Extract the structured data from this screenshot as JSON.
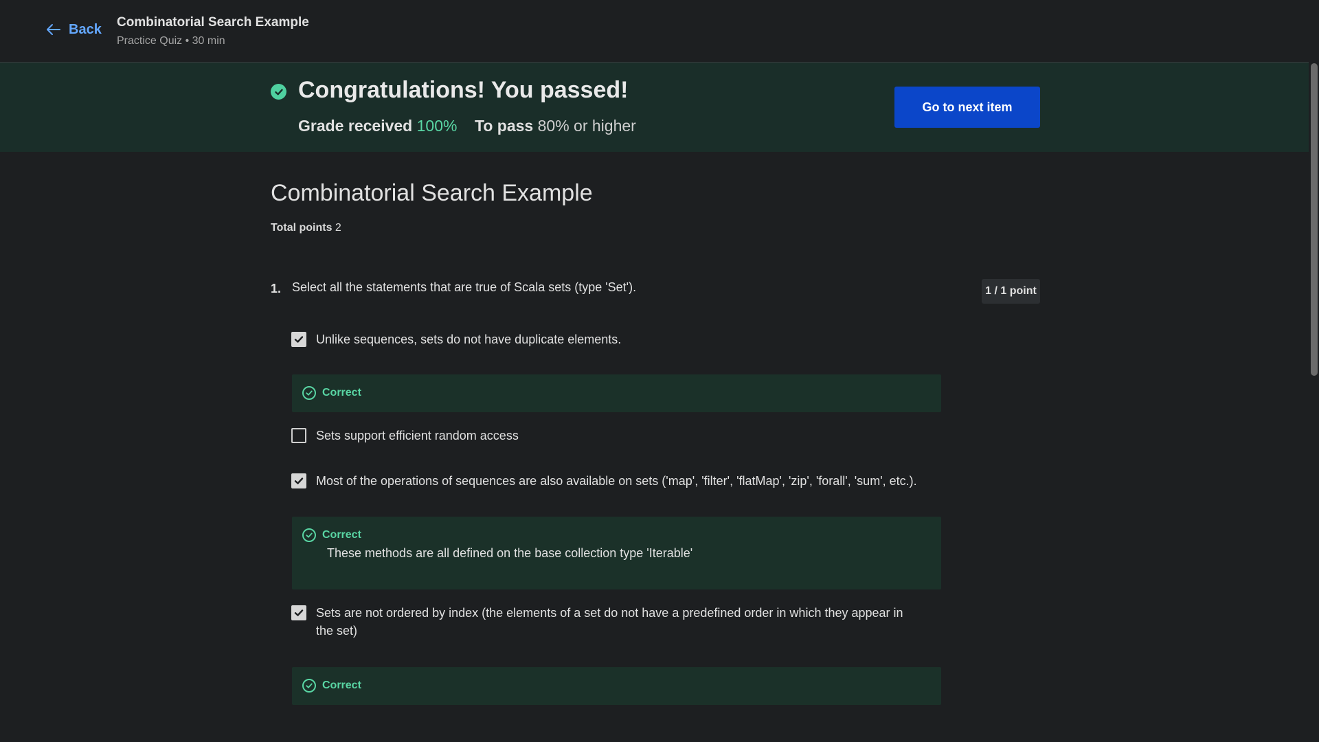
{
  "header": {
    "back_label": "Back",
    "title": "Combinatorial Search Example",
    "subtitle": "Practice Quiz • 30 min"
  },
  "banner": {
    "headline": "Congratulations! You passed!",
    "grade_label": "Grade received",
    "grade_value": "100%",
    "pass_label": "To pass",
    "pass_value": "80% or higher",
    "next_button": "Go to next item"
  },
  "quiz": {
    "title": "Combinatorial Search Example",
    "total_points_label": "Total points",
    "total_points_value": "2"
  },
  "question": {
    "number": "1.",
    "text": "Select all the statements that are true of Scala sets (type 'Set').",
    "points": "1 / 1 point",
    "options": [
      {
        "text": "Unlike sequences, sets do not have duplicate elements.",
        "checked": true
      },
      {
        "text": "Sets support efficient random access",
        "checked": false
      },
      {
        "text": "Most of the operations of sequences are also available on sets ('map', 'filter', 'flatMap', 'zip', 'forall', 'sum', etc.).",
        "checked": true
      },
      {
        "text": "Sets are not ordered by index (the elements of a set do not have a predefined order in which they appear in the set)",
        "checked": true
      }
    ],
    "feedback": [
      {
        "label": "Correct",
        "text": ""
      },
      {
        "label": "Correct",
        "text": "These methods are all defined on the base collection type 'Iterable'"
      },
      {
        "label": "Correct",
        "text": ""
      }
    ]
  },
  "icons": {
    "back": "arrow-left-icon",
    "passed": "check-circle-filled-icon",
    "checkbox": "checkbox-icon",
    "correct": "check-circle-outline-icon"
  },
  "colors": {
    "accent_blue": "#64a8ff",
    "button_blue": "#0b46c9",
    "success_green": "#59d6a4",
    "banner_bg": "#1a2e29",
    "feedback_bg": "#1b3129",
    "page_bg": "#1d1f21"
  }
}
